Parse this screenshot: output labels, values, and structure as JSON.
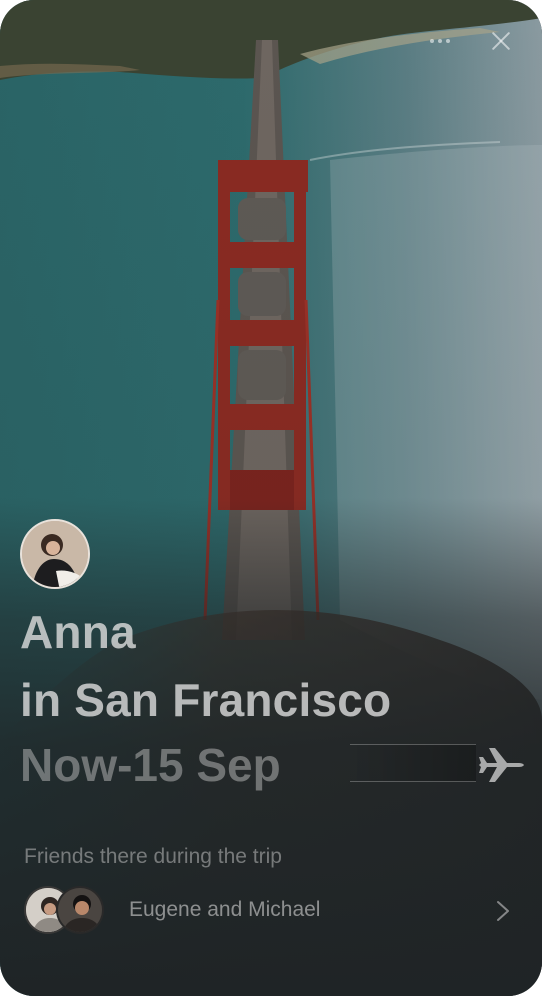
{
  "story": {
    "person_name": "Anna",
    "location_line": "in San Francisco",
    "dates": "Now-15 Sep",
    "friends_label": "Friends there during the trip",
    "friends_names": "Eugene and Michael"
  },
  "icons": {
    "close": "close-icon",
    "more": "more-dots-icon",
    "plane": "airplane-icon",
    "chevron": "chevron-right-icon"
  },
  "colors": {
    "water": "#2c6c6e",
    "bridge": "#8a2a22",
    "overlay": "#1f2426"
  }
}
